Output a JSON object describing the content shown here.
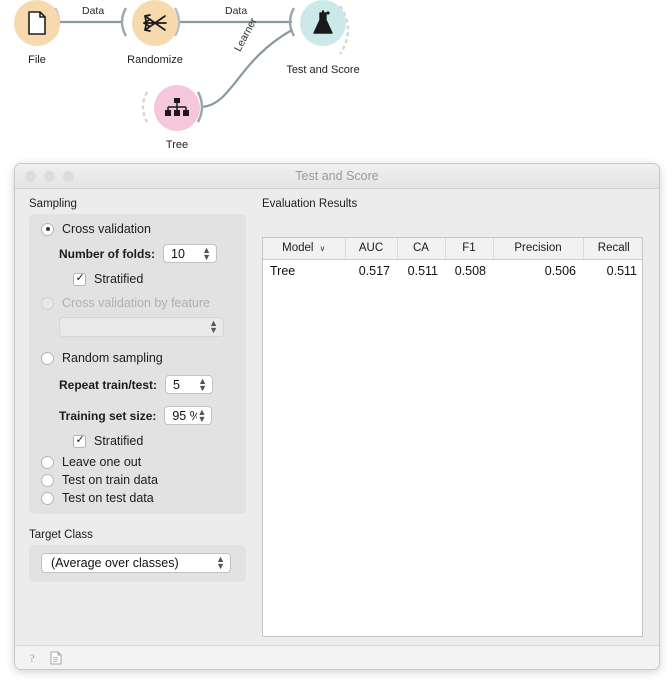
{
  "canvas": {
    "nodes": [
      {
        "id": "file",
        "label": "File",
        "icon": "file-icon"
      },
      {
        "id": "randomize",
        "label": "Randomize",
        "icon": "shuffle-icon"
      },
      {
        "id": "tree",
        "label": "Tree",
        "icon": "decision-tree-icon"
      },
      {
        "id": "test",
        "label": "Test and Score",
        "icon": "flask-icon"
      }
    ],
    "links": [
      {
        "label": "Data"
      },
      {
        "label": "Data"
      },
      {
        "label": "Learner"
      }
    ]
  },
  "window": {
    "title": "Test and Score"
  },
  "sampling": {
    "group_title": "Sampling",
    "cross_validation": {
      "label": "Cross validation",
      "selected": true,
      "folds_label": "Number of folds:",
      "folds_value": "10",
      "stratified_label": "Stratified",
      "stratified_checked": true
    },
    "cross_validation_by_feature": {
      "label": "Cross validation by feature",
      "selected": false,
      "disabled": true,
      "feature_value": ""
    },
    "random_sampling": {
      "label": "Random sampling",
      "selected": false,
      "repeat_label": "Repeat train/test:",
      "repeat_value": "5",
      "training_size_label": "Training set size:",
      "training_size_value": "95 %",
      "stratified_label": "Stratified",
      "stratified_checked": true
    },
    "leave_one_out": {
      "label": "Leave one out",
      "selected": false
    },
    "test_on_train": {
      "label": "Test on train data",
      "selected": false
    },
    "test_on_test": {
      "label": "Test on test data",
      "selected": false
    }
  },
  "target_class": {
    "group_title": "Target Class",
    "value": "(Average over classes)"
  },
  "evaluation": {
    "title": "Evaluation Results",
    "columns": [
      "Model",
      "AUC",
      "CA",
      "F1",
      "Precision",
      "Recall"
    ],
    "sorted_column": "Model",
    "sort_glyph": "∨",
    "rows": [
      {
        "model": "Tree",
        "auc": "0.517",
        "ca": "0.511",
        "f1": "0.508",
        "precision": "0.506",
        "recall": "0.511"
      }
    ]
  },
  "statusbar": {
    "help_icon": "question-mark-icon",
    "report_icon": "document-icon",
    "help_glyph": "?",
    "report_glyph": "὜E"
  },
  "colors": {
    "node_orange": "#f7d9ae",
    "node_pink": "#f6c6dc",
    "node_teal": "#cce9ea",
    "link_gray": "#8a98a0",
    "window_bg": "#ececec"
  }
}
